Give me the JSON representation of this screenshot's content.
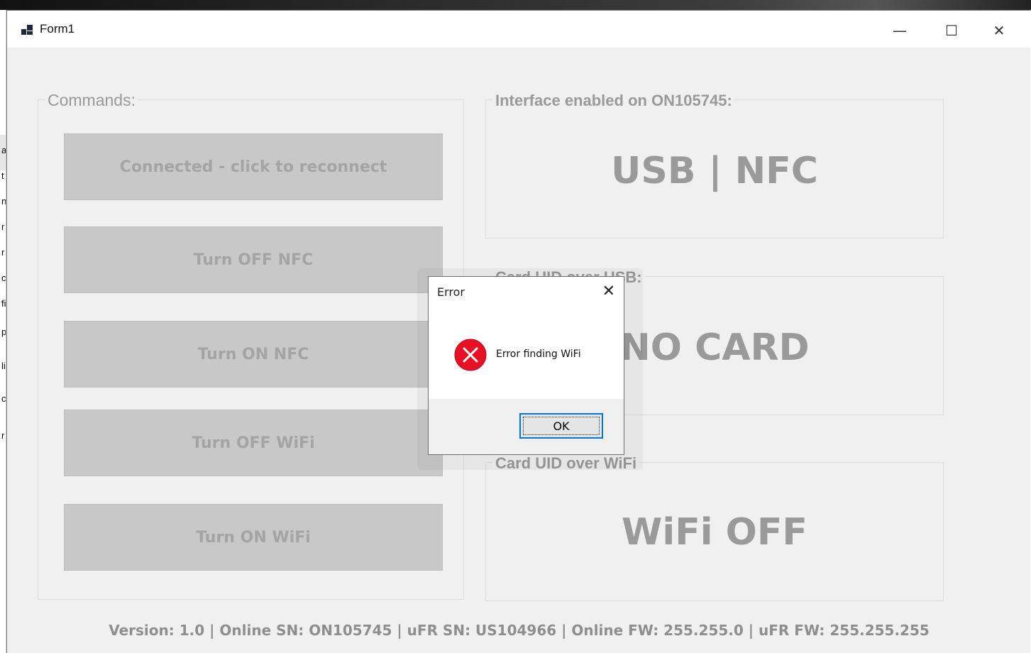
{
  "window": {
    "title": "Form1",
    "minimize_glyph": "—",
    "maximize_glyph": "☐",
    "close_glyph": "✕"
  },
  "commands": {
    "legend": "Commands:",
    "buttons": [
      "Connected - click to reconnect",
      "Turn OFF NFC",
      "Turn ON NFC",
      "Turn OFF WiFi",
      "Turn ON WiFi"
    ]
  },
  "interface_group": {
    "legend": "Interface enabled on ON105745:",
    "value": "USB | NFC"
  },
  "usb_group": {
    "legend": "Card UID over USB:",
    "value": "NO CARD"
  },
  "wifi_group": {
    "legend": "Card UID over WiFi",
    "value": "WiFi OFF"
  },
  "footer": {
    "text": "Version: 1.0 | Online SN: ON105745 | uFR SN: US104966 | Online FW: 255.255.0 | uFR FW: 255.255.255"
  },
  "dialog": {
    "title": "Error",
    "close_glyph": "✕",
    "message": "Error finding WiFi",
    "ok_label": "OK",
    "icon": "error-icon",
    "icon_color": "#e81123"
  },
  "colors": {
    "form_background": "#f0f0f0",
    "button_background": "#c8c8c8",
    "disabled_text": "#9a9a9a",
    "focus_accent": "#0078d7"
  },
  "background_fragments": [
    "a",
    "t",
    "n",
    "r",
    "r",
    "c",
    "fi",
    "p.",
    "li",
    "c",
    "r"
  ]
}
